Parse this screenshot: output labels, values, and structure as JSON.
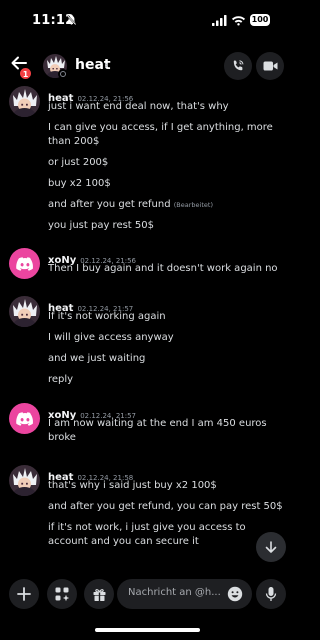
{
  "status_bar": {
    "time": "11:12",
    "battery": "100"
  },
  "header": {
    "title": "heat",
    "chevron": "›",
    "badge_count": "1"
  },
  "colors": {
    "background": "#000000",
    "discord_pink": "#eb459f",
    "badge_red": "#f23f43",
    "text": "#dbdee1",
    "muted": "#949ba4"
  },
  "messages": [
    {
      "author": "heat",
      "timestamp": "02.12.24, 21:56",
      "lines": [
        "just i want end deal now, that's why",
        "I can give you access, if I get anything, more than 200$",
        "or just 200$",
        "buy x2 100$",
        "and after you get refund",
        "you just pay rest 50$"
      ],
      "edited_label": "(Bearbeitet)"
    },
    {
      "author": "xoNy",
      "timestamp": "02.12.24, 21:56",
      "lines": [
        "Then I buy again and it doesn't work again no"
      ]
    },
    {
      "author": "heat",
      "timestamp": "02.12.24, 21:57",
      "lines": [
        "If it's not working again",
        "I will give access anyway",
        "and we just waiting",
        "reply"
      ]
    },
    {
      "author": "xoNy",
      "timestamp": "02.12.24, 21:57",
      "lines": [
        "I am now waiting at the end I am 450 euros broke"
      ]
    },
    {
      "author": "heat",
      "timestamp": "02.12.24, 21:58",
      "lines": [
        "that's why i said just buy x2 100$",
        "and after you get refund, you can pay rest 50$",
        "if it's not work, i just give you access to account and you can secure it"
      ]
    }
  ],
  "composer": {
    "placeholder": "Nachricht an @h..."
  }
}
